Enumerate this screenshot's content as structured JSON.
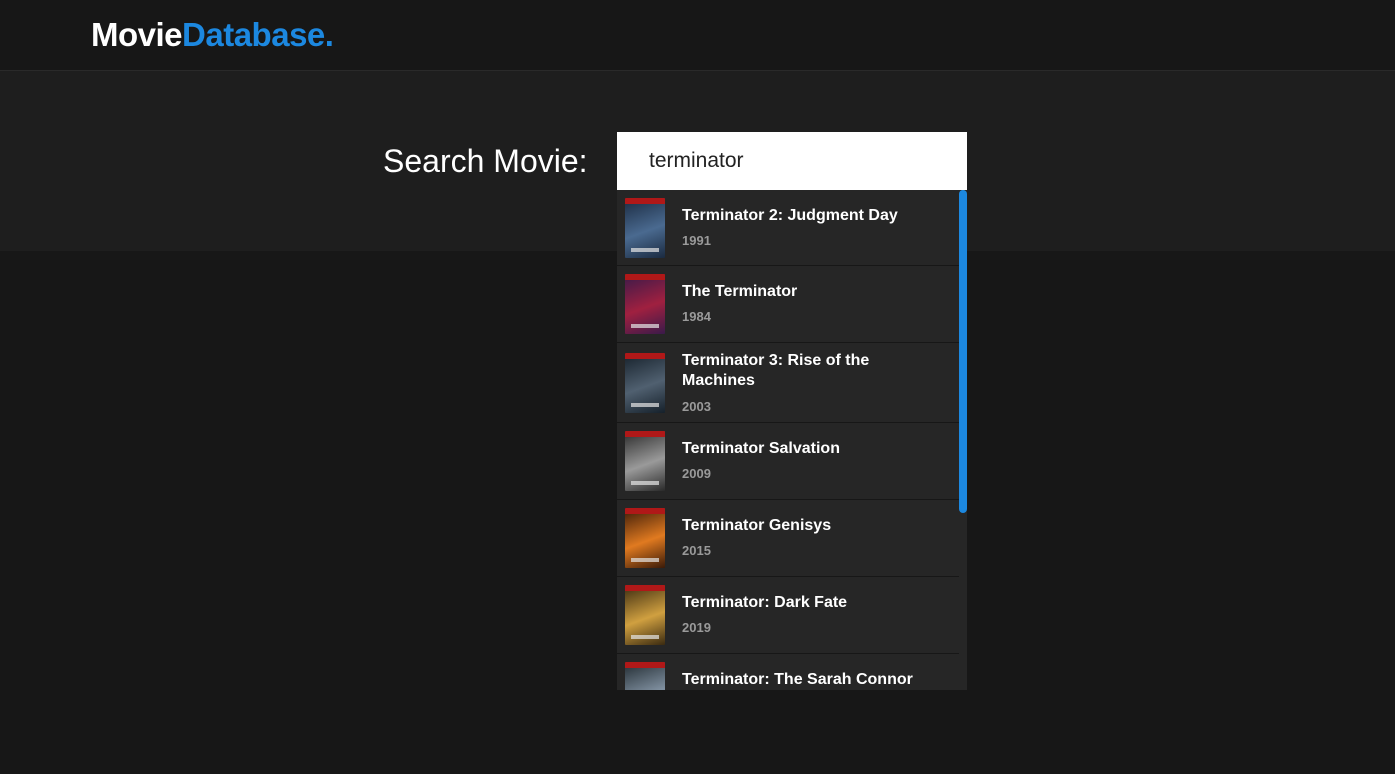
{
  "header": {
    "logo_part1": "Movie",
    "logo_part2": "Database."
  },
  "search": {
    "label": "Search Movie:",
    "value": "terminator"
  },
  "results": [
    {
      "title": "Terminator 2: Judgment Day",
      "year": "1991",
      "poster_icon": "movie-poster-icon",
      "poster_colors": [
        "#1a2a40",
        "#4a6a90"
      ]
    },
    {
      "title": "The Terminator",
      "year": "1984",
      "poster_icon": "movie-poster-icon",
      "poster_colors": [
        "#3a1a4a",
        "#a02040"
      ]
    },
    {
      "title": "Terminator 3: Rise of the Machines",
      "year": "2003",
      "poster_icon": "movie-poster-icon",
      "poster_colors": [
        "#15202a",
        "#506070"
      ]
    },
    {
      "title": "Terminator Salvation",
      "year": "2009",
      "poster_icon": "movie-poster-icon",
      "poster_colors": [
        "#2a2a2a",
        "#9a9a9a"
      ]
    },
    {
      "title": "Terminator Genisys",
      "year": "2015",
      "poster_icon": "movie-poster-icon",
      "poster_colors": [
        "#3a1a08",
        "#e07a20"
      ]
    },
    {
      "title": "Terminator: Dark Fate",
      "year": "2019",
      "poster_icon": "movie-poster-icon",
      "poster_colors": [
        "#3a2a10",
        "#d0a040"
      ]
    },
    {
      "title": "Terminator: The Sarah Connor",
      "year": "",
      "poster_icon": "movie-poster-icon",
      "poster_colors": [
        "#202a30",
        "#8090a0"
      ]
    }
  ],
  "colors": {
    "accent": "#1c88e0",
    "background": "#171717",
    "panel": "#262626"
  }
}
